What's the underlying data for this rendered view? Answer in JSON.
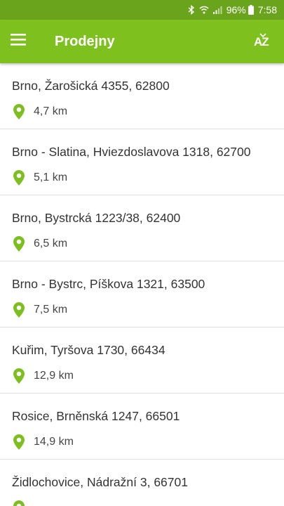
{
  "status_bar": {
    "battery_percent": "96%",
    "time": "7:58",
    "icons": [
      "bluetooth-icon",
      "wifi-icon",
      "signal-icon",
      "battery-icon"
    ]
  },
  "app_bar": {
    "title": "Prodejny",
    "sort_label": "AZ",
    "icons": [
      "menu-icon",
      "sort-az-icon"
    ]
  },
  "colors": {
    "status_bar": "#6aa31c",
    "app_bar": "#7ec11f",
    "pin": "#7cbf1e"
  },
  "stores": [
    {
      "address": "Brno, Žarošická 4355, 62800",
      "distance": "4,7 km"
    },
    {
      "address": "Brno - Slatina, Hviezdoslavova 1318, 62700",
      "distance": "5,1 km"
    },
    {
      "address": "Brno, Bystrcká 1223/38, 62400",
      "distance": "6,5 km"
    },
    {
      "address": "Brno - Bystrc, Píškova 1321, 63500",
      "distance": "7,5 km"
    },
    {
      "address": "Kuřim, Tyršova 1730, 66434",
      "distance": "12,9 km"
    },
    {
      "address": "Rosice, Brněnská 1247, 66501",
      "distance": "14,9 km"
    },
    {
      "address": "Židlochovice, Nádražní 3, 66701",
      "distance": ""
    }
  ]
}
